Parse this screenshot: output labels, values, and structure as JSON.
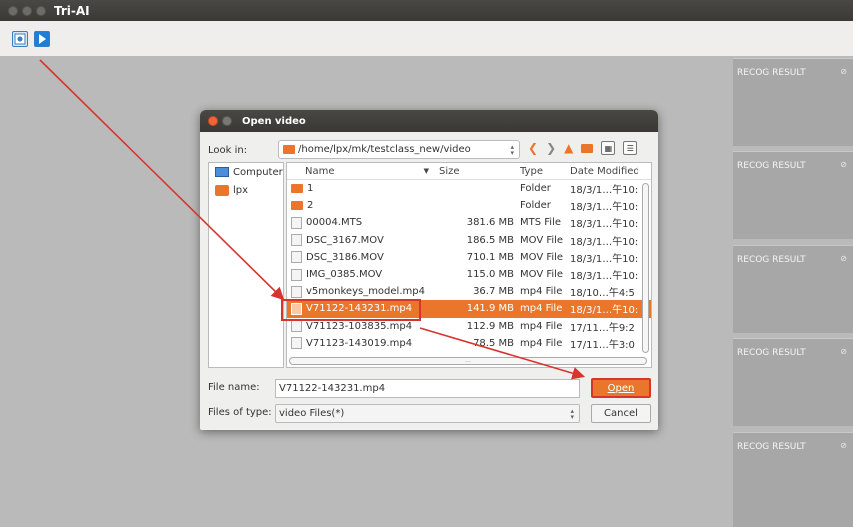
{
  "window": {
    "title": "Tri-AI"
  },
  "toolbar": {
    "buttons": [
      {
        "icon": "image-icon"
      },
      {
        "icon": "play-icon"
      }
    ]
  },
  "result_panels": [
    {
      "label": "RECOG RESULT"
    },
    {
      "label": "RECOG RESULT"
    },
    {
      "label": "RECOG RESULT"
    },
    {
      "label": "RECOG RESULT"
    },
    {
      "label": "RECOG RESULT"
    }
  ],
  "dialog": {
    "title": "Open video",
    "look_in_label": "Look in:",
    "path": "/home/lpx/mk/testclass_new/video",
    "sidebar": [
      {
        "label": "Computer"
      },
      {
        "label": "lpx"
      }
    ],
    "columns": {
      "name": "Name",
      "size": "Size",
      "type": "Type",
      "date": "Date Modified"
    },
    "files": [
      {
        "name": "1",
        "size": "",
        "type": "Folder",
        "date": "18/3/1…午10:",
        "kind": "folder"
      },
      {
        "name": "2",
        "size": "",
        "type": "Folder",
        "date": "18/3/1…午10:",
        "kind": "folder"
      },
      {
        "name": "00004.MTS",
        "size": "381.6 MB",
        "type": "MTS File",
        "date": "18/3/1…午10:",
        "kind": "file"
      },
      {
        "name": "DSC_3167.MOV",
        "size": "186.5 MB",
        "type": "MOV File",
        "date": "18/3/1…午10:",
        "kind": "file"
      },
      {
        "name": "DSC_3186.MOV",
        "size": "710.1 MB",
        "type": "MOV File",
        "date": "18/3/1…午10:",
        "kind": "file"
      },
      {
        "name": "IMG_0385.MOV",
        "size": "115.0 MB",
        "type": "MOV File",
        "date": "18/3/1…午10:",
        "kind": "file"
      },
      {
        "name": "v5monkeys_model.mp4",
        "size": "36.7 MB",
        "type": "mp4 File",
        "date": "18/10…午4:5",
        "kind": "file"
      },
      {
        "name": "V71122-143231.mp4",
        "size": "141.9 MB",
        "type": "mp4 File",
        "date": "18/3/1…午10:",
        "kind": "file",
        "selected": true
      },
      {
        "name": "V71123-103835.mp4",
        "size": "112.9 MB",
        "type": "mp4 File",
        "date": "17/11…午9:2",
        "kind": "file"
      },
      {
        "name": "V71123-143019.mp4",
        "size": "78.5 MB",
        "type": "mp4 File",
        "date": "17/11…午3:0",
        "kind": "file"
      }
    ],
    "hscroll_text": "...",
    "file_name_label": "File name:",
    "file_name_value": "V71122-143231.mp4",
    "files_of_type_label": "Files of type:",
    "files_of_type_value": "video Files(*)",
    "open_label": "Open",
    "cancel_label": "Cancel"
  },
  "colors": {
    "accent": "#e9762b",
    "highlight": "#d8342e"
  }
}
